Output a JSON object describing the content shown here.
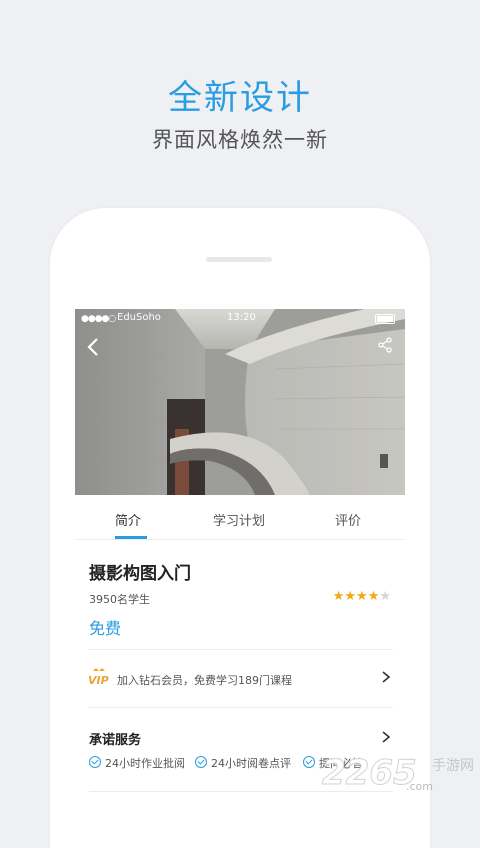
{
  "hero": {
    "title": "全新设计",
    "subtitle": "界面风格焕然一新"
  },
  "status_bar": {
    "signal": "●●●●○",
    "carrier": "EduSoho",
    "time": "13:20"
  },
  "course": {
    "tabs": [
      {
        "label": "简介",
        "active": true
      },
      {
        "label": "学习计划",
        "active": false
      },
      {
        "label": "评价",
        "active": false
      }
    ],
    "title": "摄影构图入门",
    "students": "3950名学生",
    "rating": 4,
    "rating_max": 5,
    "price": "免费",
    "vip": {
      "badge": "VIP",
      "text": "加入钻石会员，免费学习189门课程"
    },
    "promise": {
      "title": "承诺服务",
      "items": [
        "24小时作业批阅",
        "24小时阅卷点评",
        "提问必答"
      ]
    }
  },
  "watermark": {
    "number": "2265",
    "suffix": ".com",
    "label": "手游网"
  },
  "colors": {
    "accent": "#2a9de0",
    "background": "#eef0f3",
    "star": "#f3a712"
  }
}
